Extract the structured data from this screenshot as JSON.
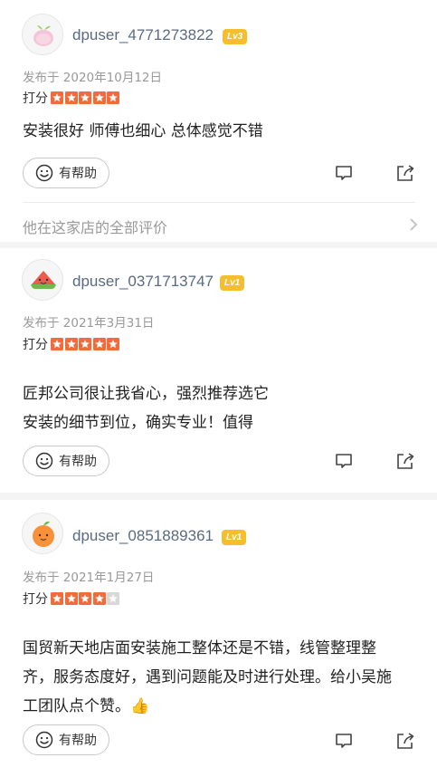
{
  "colors": {
    "star_on": "#f36b3b",
    "star_off": "#d8d8d8",
    "level_badge": "#f5be2e",
    "username": "#5a6a80"
  },
  "reviews": [
    {
      "avatar_icon": "peach-avatar-icon",
      "username": "dpuser_4771273822",
      "level": "Lv3",
      "date": "发布于 2020年10月12日",
      "rating_label": "打分",
      "stars": 5,
      "content_lines": [
        "安装很好 师傅也细心 总体感觉不错"
      ],
      "helpful_label": "有帮助",
      "all_reviews_link": "他在这家店的全部评价"
    },
    {
      "avatar_icon": "watermelon-avatar-icon",
      "username": "dpuser_0371713747",
      "level": "Lv1",
      "date": "发布于 2021年3月31日",
      "rating_label": "打分",
      "stars": 5,
      "content_lines": [
        "匠邦公司很让我省心，强烈推荐选它",
        "安装的细节到位，确实专业！值得"
      ],
      "helpful_label": "有帮助"
    },
    {
      "avatar_icon": "orange-avatar-icon",
      "username": "dpuser_0851889361",
      "level": "Lv1",
      "date": "发布于 2021年1月27日",
      "rating_label": "打分",
      "stars": 4,
      "content_lines": [
        "国贸新天地店面安装施工整体还是不错，线管整理整",
        "齐，服务态度好，遇到问题能及时进行处理。给小吴施",
        "工团队点个赞。👍"
      ],
      "helpful_label": "有帮助"
    }
  ]
}
